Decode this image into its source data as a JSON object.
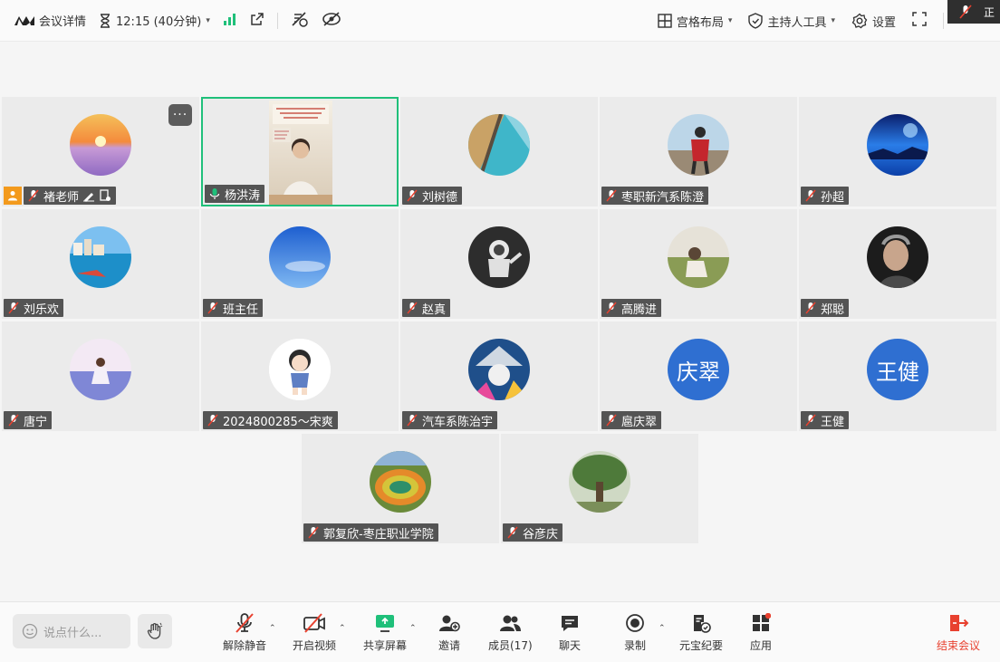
{
  "topbar": {
    "meeting_details": "会议详情",
    "timer": "12:15 (40分钟)",
    "layout": "宫格布局",
    "host_tools": "主持人工具",
    "settings": "设置",
    "corner_text": "正"
  },
  "participants": [
    {
      "name": "褚老师",
      "avatar": "lavender-sunset",
      "host": true
    },
    {
      "name": "杨洪涛",
      "avatar": "video",
      "speaking": true
    },
    {
      "name": "刘树德",
      "avatar": "coast-road"
    },
    {
      "name": "枣职新汽系陈澄",
      "avatar": "red-jacket-hiker"
    },
    {
      "name": "孙超",
      "avatar": "blue-lake"
    },
    {
      "name": "刘乐欢",
      "avatar": "seaside-town"
    },
    {
      "name": "班主任",
      "avatar": "blue-sky"
    },
    {
      "name": "赵真",
      "avatar": "astronaut"
    },
    {
      "name": "高腾进",
      "avatar": "grass-field"
    },
    {
      "name": "郑聪",
      "avatar": "man-portrait"
    },
    {
      "name": "唐宁",
      "avatar": "flower-field"
    },
    {
      "name": "2024800285～宋爽",
      "avatar": "cartoon-girl"
    },
    {
      "name": "汽车系陈治宇",
      "avatar": "shark-astronaut"
    },
    {
      "name": "扈庆翠",
      "avatar": "text",
      "avatar_text": "庆翠"
    },
    {
      "name": "王健",
      "avatar": "text",
      "avatar_text": "王健"
    },
    {
      "name": "郭复欣-枣庄职业学院",
      "avatar": "hot-spring"
    },
    {
      "name": "谷彦庆",
      "avatar": "big-tree"
    }
  ],
  "toolbar": {
    "chat_placeholder": "说点什么...",
    "unmute": "解除静音",
    "start_video": "开启视频",
    "share_screen": "共享屏幕",
    "invite": "邀请",
    "members": "成员(17)",
    "chat": "聊天",
    "record": "录制",
    "minutes": "元宝纪要",
    "apps": "应用",
    "end_meeting": "结束会议"
  },
  "colors": {
    "accent_green": "#1fc07a",
    "end_red": "#e8412f",
    "host_orange": "#f39a1d",
    "text_avatar_blue": "#2f6fd1"
  }
}
